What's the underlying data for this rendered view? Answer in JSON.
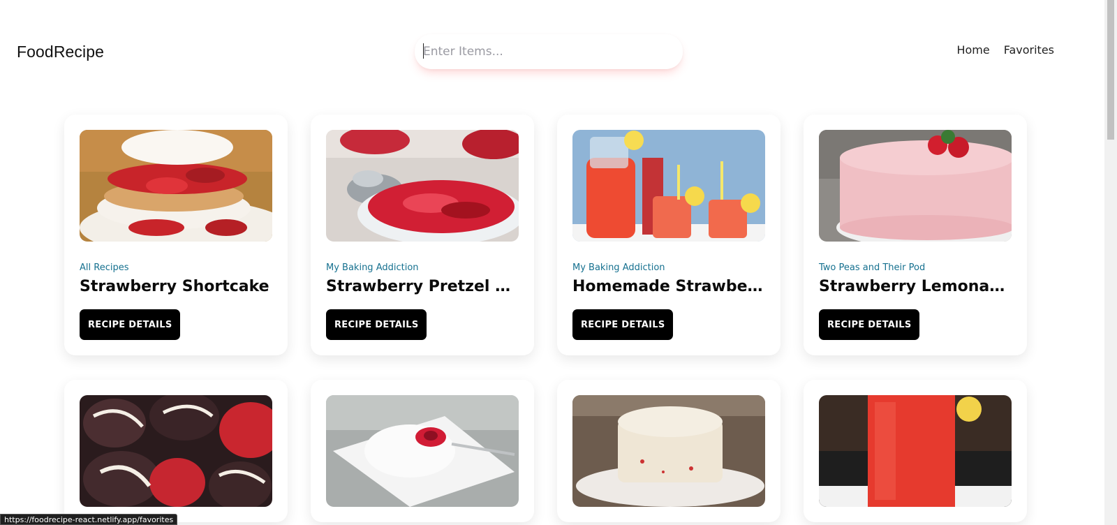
{
  "header": {
    "logo": "FoodRecipe",
    "search": {
      "placeholder": "Enter Items...",
      "value": ""
    },
    "nav": [
      {
        "label": "Home"
      },
      {
        "label": "Favorites"
      }
    ]
  },
  "recipes": [
    {
      "source": "All Recipes",
      "title": "Strawberry Shortcake",
      "button": "RECIPE DETAILS",
      "image": "shortcake-photo"
    },
    {
      "source": "My Baking Addiction",
      "title": "Strawberry Pretzel Salad",
      "button": "RECIPE DETAILS",
      "image": "pretzel-salad-photo"
    },
    {
      "source": "My Baking Addiction",
      "title": "Homemade Strawberry Lemonade",
      "button": "RECIPE DETAILS",
      "image": "lemonade-pitcher-photo"
    },
    {
      "source": "Two Peas and Their Pod",
      "title": "Strawberry Lemonade Cake",
      "button": "RECIPE DETAILS",
      "image": "pink-cake-photo"
    },
    {
      "source": "",
      "title": "",
      "button": "",
      "image": "chocolate-strawberries-photo"
    },
    {
      "source": "",
      "title": "",
      "button": "",
      "image": "angel-cake-photo"
    },
    {
      "source": "",
      "title": "",
      "button": "",
      "image": "frosted-cake-photo"
    },
    {
      "source": "",
      "title": "",
      "button": "",
      "image": "strawberry-drink-photo"
    }
  ],
  "statusbar": {
    "url": "https://foodrecipe-react.netlify.app/favorites"
  },
  "colors": {
    "accent_source": "#15708f",
    "button_bg": "#000000",
    "search_glow": "#ff5a5a"
  }
}
